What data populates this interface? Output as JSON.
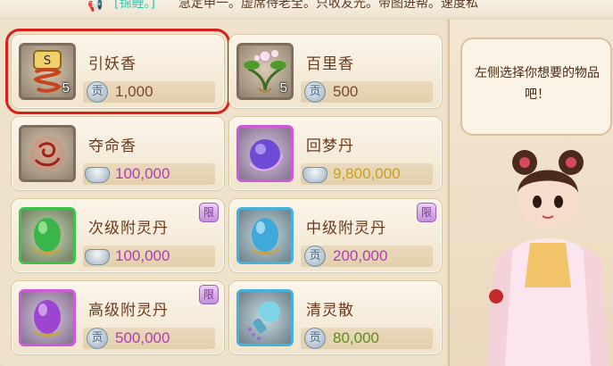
{
  "marquee": {
    "tag": "[锦鲤。]",
    "text": "急定申一。虚席待老全。只收友光。带图进帮。速度私"
  },
  "shop": {
    "items": [
      {
        "name": "引妖香",
        "count": "5",
        "currency": "贡",
        "price": "1,000",
        "price_color": "#7a4a2c",
        "frame": "gray",
        "icon": "incense-coil-icon",
        "limited": false,
        "selected": true
      },
      {
        "name": "百里香",
        "count": "5",
        "currency": "贡",
        "price": "500",
        "price_color": "#7a4a2c",
        "frame": "gray",
        "icon": "herb-flower-icon",
        "limited": false,
        "selected": false
      },
      {
        "name": "夺命香",
        "count": "",
        "currency": "silver",
        "price": "100,000",
        "price_color": "#b13bb8",
        "frame": "gray",
        "icon": "red-swirl-icon",
        "limited": false,
        "selected": false
      },
      {
        "name": "回梦丹",
        "count": "",
        "currency": "silver",
        "price": "9,800,000",
        "price_color": "#c9a11a",
        "frame": "purple",
        "icon": "purple-pill-icon",
        "limited": false,
        "selected": false
      },
      {
        "name": "次级附灵丹",
        "count": "",
        "currency": "silver",
        "price": "100,000",
        "price_color": "#b13bb8",
        "frame": "green",
        "icon": "green-orb-icon",
        "limited": true,
        "limit_label": "限",
        "selected": false
      },
      {
        "name": "中级附灵丹",
        "count": "",
        "currency": "贡",
        "price": "200,000",
        "price_color": "#b13bb8",
        "frame": "blue",
        "icon": "blue-orb-icon",
        "limited": true,
        "limit_label": "限",
        "selected": false
      },
      {
        "name": "高级附灵丹",
        "count": "",
        "currency": "贡",
        "price": "500,000",
        "price_color": "#b13bb8",
        "frame": "purple",
        "icon": "purple-orb-icon",
        "limited": true,
        "limit_label": "限",
        "selected": false
      },
      {
        "name": "清灵散",
        "count": "",
        "currency": "贡",
        "price": "80,000",
        "price_color": "#5a8f1e",
        "frame": "blue",
        "icon": "potion-bottle-icon",
        "limited": false,
        "selected": false
      }
    ]
  },
  "npc": {
    "speech": "左侧选择你想要的物品吧！",
    "icon": "npc-girl-portrait"
  },
  "colors": {
    "selected_outline": "#d8201d",
    "panel_bg": "#efe2cb"
  }
}
